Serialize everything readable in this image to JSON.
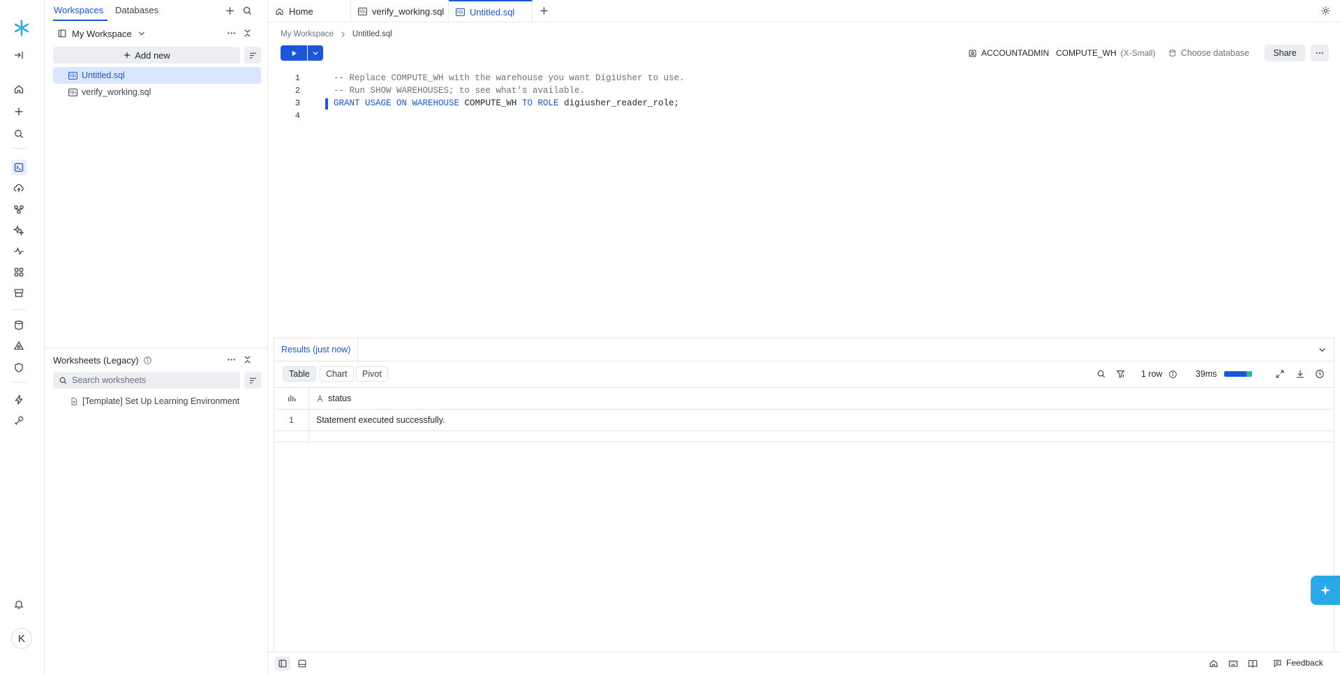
{
  "colors": {
    "accent": "#1a56db",
    "ai_button": "#29a9e8",
    "selected_row": "#dbe7ff"
  },
  "rail": {
    "icons": [
      "snowflake-logo",
      "collapse-rail-icon",
      "home-icon",
      "plus-icon",
      "search-icon",
      "sql-editor-icon",
      "data-ingest-icon",
      "projects-icon",
      "ai-ml-icon",
      "monitoring-icon",
      "apps-icon",
      "marketplace-icon",
      "data-icon",
      "governance-icon",
      "security-icon",
      "horizon-icon",
      "admin-icon",
      "notifications-icon"
    ],
    "avatar_initial": "K"
  },
  "panel": {
    "tabs": [
      "Workspaces",
      "Databases"
    ],
    "workspace_name": "My Workspace",
    "add_new_label": "Add new",
    "files": [
      {
        "name": "Untitled.sql",
        "active": true
      },
      {
        "name": "verify_working.sql",
        "active": false
      }
    ],
    "legacy": {
      "title": "Worksheets (Legacy)",
      "search_placeholder": "Search worksheets",
      "items": [
        "[Template] Set Up Learning Environment"
      ]
    }
  },
  "editor_tabs": [
    {
      "label": "Home",
      "icon": "home-icon",
      "active": false
    },
    {
      "label": "verify_working.sql",
      "icon": "sql-file-icon",
      "active": false
    },
    {
      "label": "Untitled.sql",
      "icon": "sql-file-icon",
      "active": true
    }
  ],
  "breadcrumb": {
    "root": "My Workspace",
    "current": "Untitled.sql"
  },
  "context": {
    "role": "ACCOUNTADMIN",
    "warehouse": "COMPUTE_WH",
    "warehouse_size": "(X-Small)",
    "database": "Choose database",
    "share_label": "Share"
  },
  "editor": {
    "line_numbers": [
      "1",
      "2",
      "3",
      "4"
    ],
    "lines": [
      "-- Replace COMPUTE_WH with the warehouse you want DigiUsher to use.",
      "-- Run SHOW WAREHOUSES; to see what's available.",
      "GRANT USAGE ON WAREHOUSE COMPUTE_WH TO ROLE digiusher_reader_role;",
      ""
    ],
    "line3_parts": [
      "GRANT USAGE ON WAREHOUSE",
      " COMPUTE_WH ",
      "TO ROLE",
      " digiusher_reader_role;"
    ]
  },
  "results": {
    "tab_label": "Results (just now)",
    "views": [
      "Table",
      "Chart",
      "Pivot"
    ],
    "row_count": "1 row",
    "duration": "39ms",
    "column": "status",
    "rows": [
      {
        "index": "1",
        "status": "Statement executed successfully."
      }
    ]
  },
  "bottom": {
    "feedback_label": "Feedback"
  }
}
